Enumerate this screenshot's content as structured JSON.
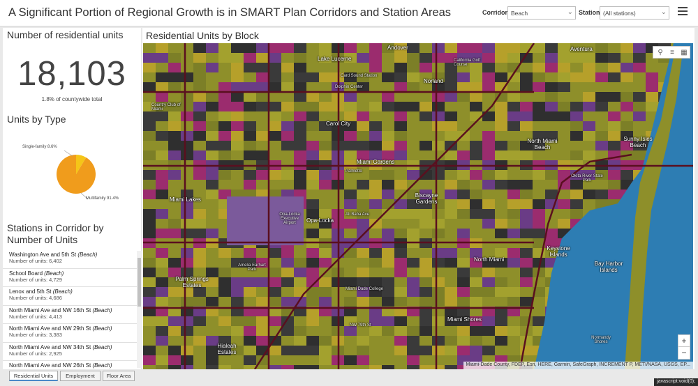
{
  "header": {
    "title": "A Significant Portion of Regional Growth is in SMART Plan Corridors and Station Areas",
    "corridor_label": "Corridor",
    "corridor_value": "Beach",
    "station_label": "Station",
    "station_value": "(All stations)"
  },
  "summary": {
    "title": "Number of residential units",
    "value": "18,103",
    "subtext": "1.8% of countywide total"
  },
  "units_by_type": {
    "title": "Units by Type",
    "slices": [
      {
        "label": "Single-family 8.6%",
        "value": 8.6,
        "color": "#f5c518"
      },
      {
        "label": "Multifamily 91.4%",
        "value": 91.4,
        "color": "#f09c1c"
      }
    ]
  },
  "stations": {
    "title": "Stations in Corridor by Number of Units",
    "items": [
      {
        "name": "Washington Ave and 5th St",
        "corridor": "(Beach)",
        "units": "Number of units: 6,402"
      },
      {
        "name": "School Board",
        "corridor": "(Beach)",
        "units": "Number of units: 4,729"
      },
      {
        "name": "Lenox and 5th St",
        "corridor": "(Beach)",
        "units": "Number of units: 4,686"
      },
      {
        "name": "North Miami Ave and NW 16th St",
        "corridor": "(Beach)",
        "units": "Number of units: 4,413"
      },
      {
        "name": "North Miami Ave and NW 29th St",
        "corridor": "(Beach)",
        "units": "Number of units: 3,383"
      },
      {
        "name": "North Miami Ave and NW 34th St",
        "corridor": "(Beach)",
        "units": "Number of units: 2,925"
      },
      {
        "name": "North Miami Ave and NW 26th St",
        "corridor": "(Beach)",
        "units": ""
      }
    ]
  },
  "map": {
    "title": "Residential Units by Block",
    "attribution": "Miami-Dade County, FDEP, Esri, HERE, Garmin, SafeGraph, INCREMENT P, METI/NASA, USGS, EP...",
    "labels": {
      "andover": "Andover",
      "aventura": "Aventura",
      "lake_lucerne": "Lake Lucerne",
      "card_sound": "Card Sound Station",
      "dolphin_center": "Dolphin Center",
      "norland": "Norland",
      "california_golf": "California Golf Course",
      "country_club_miami": "Country Club of Miami",
      "carol_city": "Carol City",
      "north_miami_beach": "North Miami Beach",
      "sunny_isles": "Sunny Isles Beach",
      "miami_gardens": "Miami Gardens",
      "palmetto": "Palmetto",
      "miami_lakes": "Miami Lakes",
      "opa_locka": "Opa-Locka",
      "opa_locka_airport": "Opa-Locka Executive Airport",
      "biscayne_gardens": "Biscayne Gardens",
      "oleta_river": "Oleta River State Park",
      "keystone_islands": "Keystone Islands",
      "north_miami": "North Miami",
      "bay_harbor": "Bay Harbor Islands",
      "palm_springs": "Palm Springs Estates",
      "amelia_earhart": "Amelia Earhart Park",
      "miami_shores": "Miami Shores",
      "hialeah_estates": "Hialeah Estates",
      "normandy_shores": "Normandy Shores",
      "miami_dade_college": "Miami Dade College",
      "ali_baba": "Ali Baba Ave",
      "nw_79": "NW 79th St"
    }
  },
  "tabs": [
    "Residential Units",
    "Employment",
    "Floor Area"
  ],
  "status": "javascript:void(0);",
  "colors": {
    "olive": "#8e8f2a",
    "purple": "#6a3c86",
    "magenta": "#9b2c6e",
    "water": "#2d7db3",
    "dark": "#262626"
  }
}
